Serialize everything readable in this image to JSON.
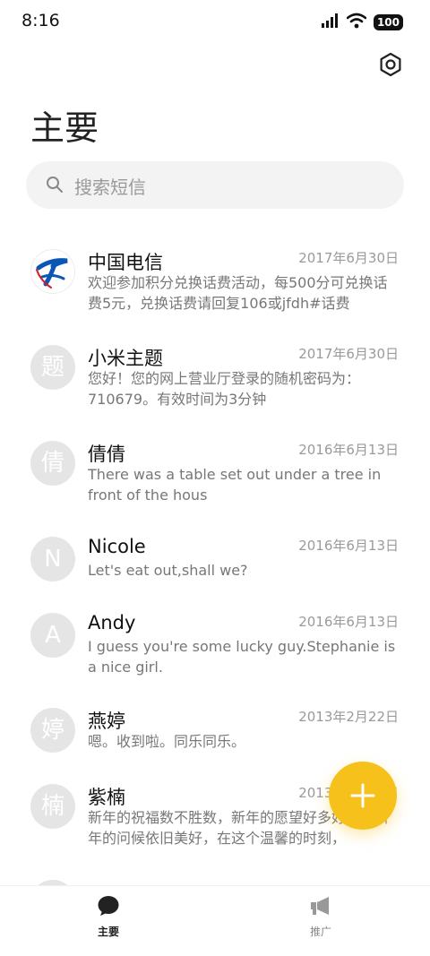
{
  "status_bar": {
    "time": "8:16",
    "battery": "100"
  },
  "header": {
    "title": "主要"
  },
  "search": {
    "placeholder": "搜索短信"
  },
  "messages": [
    {
      "sender": "中国电信",
      "date": "2017年6月30日",
      "preview": "欢迎参加积分兑换话费活动，每500分可兑换话费5元，兑换话费请回复106或jfdh#话费",
      "avatar": ""
    },
    {
      "sender": "小米主题",
      "date": "2017年6月30日",
      "preview": "您好！您的网上营业厅登录的随机密码为：710679。有效时间为3分钟",
      "avatar": "题"
    },
    {
      "sender": "倩倩",
      "date": "2016年6月13日",
      "preview": "There was a table set out under a tree in front of the hous",
      "avatar": "倩"
    },
    {
      "sender": "Nicole",
      "date": "2016年6月13日",
      "preview": "Let's eat out,shall we?",
      "avatar": "N"
    },
    {
      "sender": "Andy",
      "date": "2016年6月13日",
      "preview": "I guess you're some lucky guy.Stephanie is a nice girl.",
      "avatar": "A"
    },
    {
      "sender": "燕婷",
      "date": "2013年2月22日",
      "preview": "嗯。收到啦。同乐同乐。",
      "avatar": "婷"
    },
    {
      "sender": "紫楠",
      "date": "2013年2月22日",
      "preview": "新年的祝福数不胜数，新年的愿望好多好多，新年的问候依旧美好，在这个温馨的时刻，",
      "avatar": "楠"
    }
  ],
  "bottom_nav": {
    "main_label": "主要",
    "promo_label": "推广"
  },
  "colors": {
    "accent": "#f6c11b",
    "telecom_blue": "#0a57b5"
  }
}
